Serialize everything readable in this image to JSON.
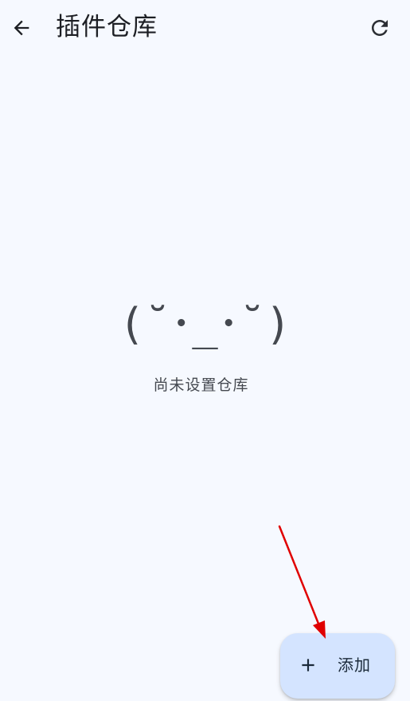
{
  "header": {
    "title": "插件仓库",
    "back_icon": "arrow-back-icon",
    "refresh_icon": "refresh-icon"
  },
  "empty_state": {
    "face": "(˘･_･˘)",
    "message": "尚未设置仓库"
  },
  "fab": {
    "icon": "plus-icon",
    "label": "添加"
  },
  "colors": {
    "background": "#f6f9ff",
    "fab_background": "#d4e4ff",
    "annotation_arrow": "#e00000"
  }
}
